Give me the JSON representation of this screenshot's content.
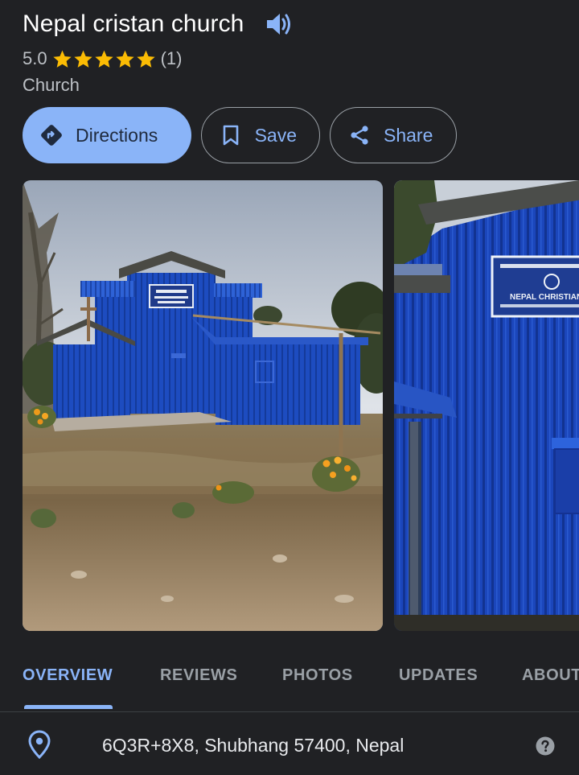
{
  "place": {
    "name": "Nepal cristan church",
    "rating": "5.0",
    "review_count": "(1)",
    "stars": 5,
    "category": "Church"
  },
  "actions": {
    "directions": "Directions",
    "save": "Save",
    "share": "Share"
  },
  "photos": {
    "sign_text": "NEPAL CHRISTIAN CH",
    "sign_text_small": "NEPAL CHRISTIAN CHURCH"
  },
  "tabs": [
    "OVERVIEW",
    "REVIEWS",
    "PHOTOS",
    "UPDATES",
    "ABOUT"
  ],
  "active_tab": "OVERVIEW",
  "address": "6Q3R+8X8, Shubhang 57400, Nepal",
  "colors": {
    "background": "#202124",
    "accent": "#8ab4f8",
    "star": "#fbbc04",
    "church_blue": "#1f4fc2"
  }
}
